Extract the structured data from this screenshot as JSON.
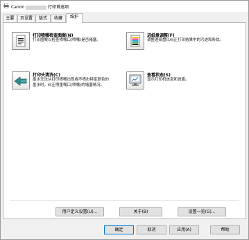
{
  "window": {
    "title_prefix": "Canon",
    "title_suffix": "打印首选项"
  },
  "tabs": [
    {
      "label": "主要"
    },
    {
      "label": "页设置"
    },
    {
      "label": "版式"
    },
    {
      "label": "收藏"
    },
    {
      "label": "维护",
      "active": true
    }
  ],
  "maintenance": {
    "nozzle_check": {
      "label": "打印喷嘴检查图案(N)",
      "desc": "打印图案以检查喷嘴口(喷嘴)是否堵塞。"
    },
    "printhead_cleaning": {
      "label": "打印头清洗(C)",
      "desc_line1": "墨水无法从打印喷嘴出现或不喷出特定颜色的",
      "desc_line2": "墨水时，纠正喷墨嘴口(喷嘴)的堵塞情况。"
    },
    "paper_adjust": {
      "label": "进纸盘调整(F)",
      "desc": "调整进纸盘以纠正打印结果中的污迹和条纹。"
    },
    "view_status": {
      "label": "查看状态(S)",
      "desc": "显示打印机信息和设置。"
    }
  },
  "buttons": {
    "custom_settings": "用户定义设置(U)...",
    "about": "关于(B)",
    "settings_list": "设置一览(G)...",
    "ok": "确定",
    "cancel": "取消",
    "apply": "应用(A)",
    "help": "帮助"
  }
}
